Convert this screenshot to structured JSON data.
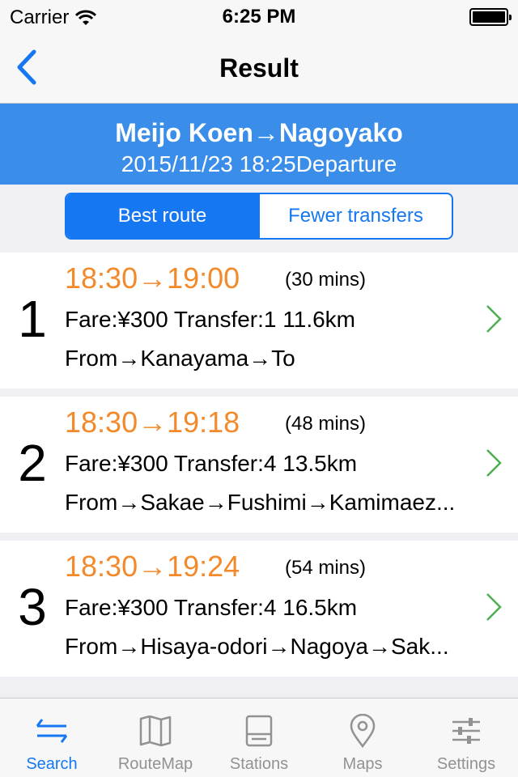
{
  "status_bar": {
    "carrier": "Carrier",
    "time": "6:25 PM"
  },
  "nav": {
    "title": "Result",
    "back_icon": "chevron-left-icon"
  },
  "banner": {
    "route": "Meijo Koen→Nagoyako",
    "datetime": "2015/11/23 18:25Departure"
  },
  "segments": {
    "best_route": "Best route",
    "fewer_transfers": "Fewer transfers",
    "selected": "Best route"
  },
  "results": [
    {
      "index": "1",
      "times": "18:30→19:00",
      "duration": "(30 mins)",
      "fare": "Fare:¥300 Transfer:1 11.6km",
      "path": "From→Kanayama→To"
    },
    {
      "index": "2",
      "times": "18:30→19:18",
      "duration": "(48 mins)",
      "fare": "Fare:¥300 Transfer:4 13.5km",
      "path": "From→Sakae→Fushimi→Kamimaez..."
    },
    {
      "index": "3",
      "times": "18:30→19:24",
      "duration": "(54 mins)",
      "fare": "Fare:¥300 Transfer:4 16.5km",
      "path": "From→Hisaya-odori→Nagoya→Sak..."
    }
  ],
  "tabs": [
    {
      "label": "Search",
      "icon": "transfer-arrows-icon",
      "active": true
    },
    {
      "label": "RouteMap",
      "icon": "map-icon",
      "active": false
    },
    {
      "label": "Stations",
      "icon": "station-board-icon",
      "active": false
    },
    {
      "label": "Maps",
      "icon": "location-pin-icon",
      "active": false
    },
    {
      "label": "Settings",
      "icon": "sliders-icon",
      "active": false
    }
  ],
  "colors": {
    "accent": "#1677f2",
    "banner": "#3a8de8",
    "time_orange": "#f28a2b",
    "chevron_green": "#4caf50",
    "tab_inactive": "#929292"
  }
}
